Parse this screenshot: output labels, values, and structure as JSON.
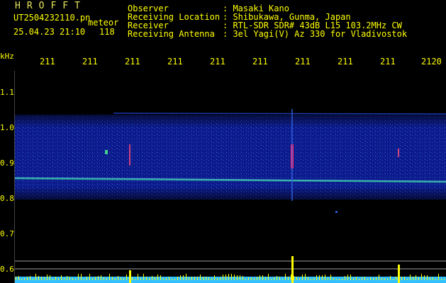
{
  "header": {
    "brand": "HROFFT",
    "filename": "UT2504232110.pn",
    "mode": "meteor",
    "timestamp": "25.04.23 21:10",
    "count": "118",
    "info": [
      {
        "label": "Observer",
        "value": ": Masaki Kano"
      },
      {
        "label": "Receiving Location",
        "value": ": Shibukawa, Gunma, Japan"
      },
      {
        "label": "Receiver",
        "value": ": RTL-SDR SDR# 43dB L15 103.2MHz CW"
      },
      {
        "label": "Receiving Antenna",
        "value": ": 3el Yagi(V) Az 330 for Vladivostok"
      }
    ]
  },
  "axis": {
    "unit": "kHz",
    "x_ticks": [
      "211",
      "211",
      "211",
      "211",
      "211",
      "211",
      "211",
      "211",
      "211",
      "2120"
    ],
    "y_ticks": [
      "1.1",
      "1.0",
      "0.9",
      "0.8",
      "0.7",
      "0.6"
    ]
  },
  "colors": {
    "background": "#000000",
    "text": "#ffff00",
    "noise_band": "#1020a0",
    "carrier": "#30c0a0",
    "meteor": "#ff2060",
    "level_bars": "#30c0ff"
  }
}
